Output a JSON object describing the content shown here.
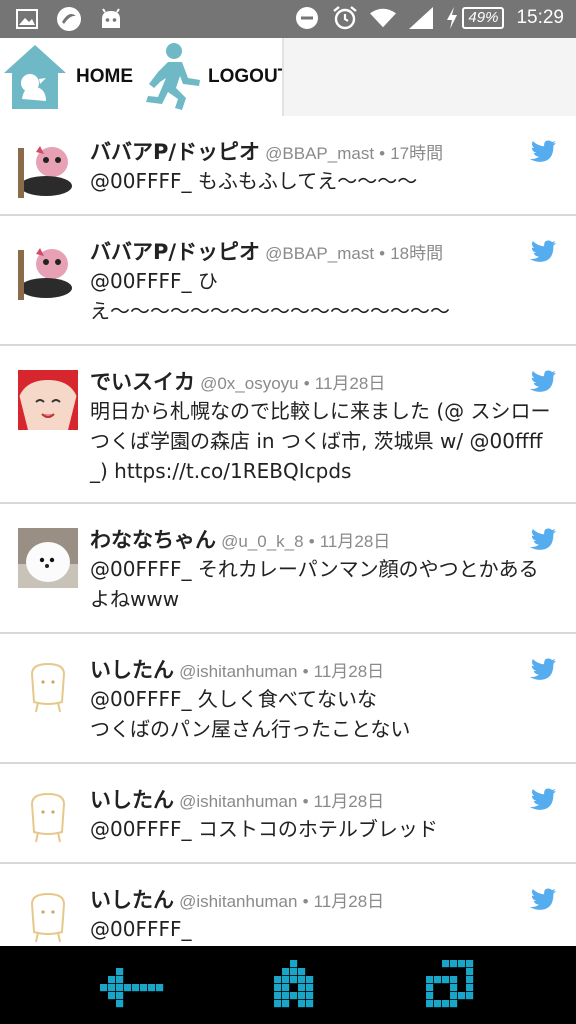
{
  "status_bar": {
    "time": "15:29",
    "battery": "49%",
    "icons": [
      "gallery-icon",
      "app-icon",
      "android-icon",
      "dnd-icon",
      "alarm-icon",
      "wifi-icon",
      "signal-icon",
      "charging-icon"
    ]
  },
  "header": {
    "home_label": "HOME",
    "logout_label": "LOGOUT"
  },
  "colors": {
    "accent": "#6fb8c6",
    "twitter": "#55acee",
    "nav": "#1aa6c9"
  },
  "tweets": [
    {
      "name": "ババアP/ドッピオ",
      "handle": "@BBAP_mast",
      "time": "17時間",
      "text": "@00FFFF_ もふもふしてえ〜〜〜〜"
    },
    {
      "name": "ババアP/ドッピオ",
      "handle": "@BBAP_mast",
      "time": "18時間",
      "text": "@00FFFF_ ひ\nえ〜〜〜〜〜〜〜〜〜〜〜〜〜〜〜〜〜"
    },
    {
      "name": "でいスイカ",
      "handle": "@0x_osyoyu",
      "time": "11月28日",
      "text": "明日から札幌なので比較しに来ました (@ スシロー つくば学園の森店 in つくば市, 茨城県 w/ @00ffff_) https://t.co/1REBQIcpds"
    },
    {
      "name": "わななちゃん",
      "handle": "@u_0_k_8",
      "time": "11月28日",
      "text": "@00FFFF_ それカレーパンマン顔のやつとかあるよねwww"
    },
    {
      "name": "いしたん",
      "handle": "@ishitanhuman",
      "time": "11月28日",
      "text": "@00FFFF_ 久しく食べてないな\nつくばのパン屋さん行ったことない"
    },
    {
      "name": "いしたん",
      "handle": "@ishitanhuman",
      "time": "11月28日",
      "text": "@00FFFF_ コストコのホテルブレッド"
    },
    {
      "name": "いしたん",
      "handle": "@ishitanhuman",
      "time": "11月28日",
      "text": "@00FFFF_"
    }
  ],
  "separator": "•"
}
